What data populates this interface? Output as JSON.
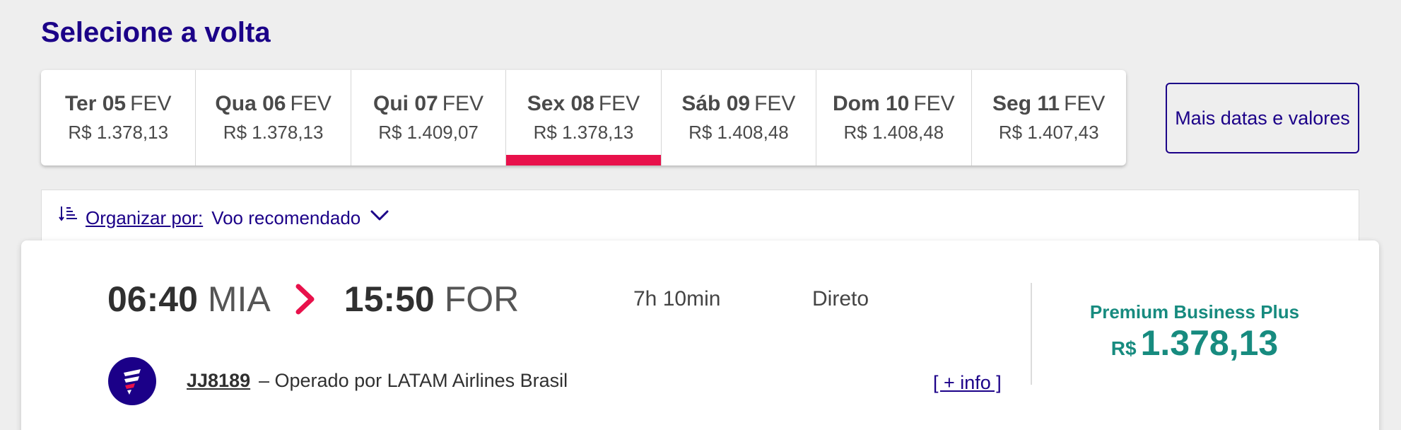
{
  "page": {
    "title": "Selecione a volta"
  },
  "date_tabs": [
    {
      "day": "Ter 05",
      "month": "FEV",
      "price": "R$ 1.378,13",
      "active": false
    },
    {
      "day": "Qua 06",
      "month": "FEV",
      "price": "R$ 1.378,13",
      "active": false
    },
    {
      "day": "Qui 07",
      "month": "FEV",
      "price": "R$ 1.409,07",
      "active": false
    },
    {
      "day": "Sex 08",
      "month": "FEV",
      "price": "R$ 1.378,13",
      "active": true
    },
    {
      "day": "Sáb 09",
      "month": "FEV",
      "price": "R$ 1.408,48",
      "active": false
    },
    {
      "day": "Dom 10",
      "month": "FEV",
      "price": "R$ 1.408,48",
      "active": false
    },
    {
      "day": "Seg 11",
      "month": "FEV",
      "price": "R$ 1.407,43",
      "active": false
    }
  ],
  "more_dates_label": "Mais datas e valores",
  "sort": {
    "label": "Organizar por:",
    "value": "Voo recomendado"
  },
  "flight": {
    "departure_time": "06:40",
    "departure_airport": "MIA",
    "arrival_time": "15:50",
    "arrival_airport": "FOR",
    "duration": "7h 10min",
    "stops": "Direto",
    "fare_class": "Premium Business Plus",
    "currency": "R$",
    "price": "1.378,13",
    "flight_code": "JJ8189",
    "operator": "– Operado por LATAM Airlines Brasil",
    "more_info": "[ + info ]"
  },
  "colors": {
    "brand": "#1b0088",
    "accent": "#e8114b",
    "fare": "#178b7f",
    "background": "#eeeeee"
  },
  "icons": {
    "sort": "sort-lines-icon",
    "chevron": "chevron-down-icon",
    "arrow": "chevron-right-icon",
    "airline": "latam-logo-icon"
  }
}
